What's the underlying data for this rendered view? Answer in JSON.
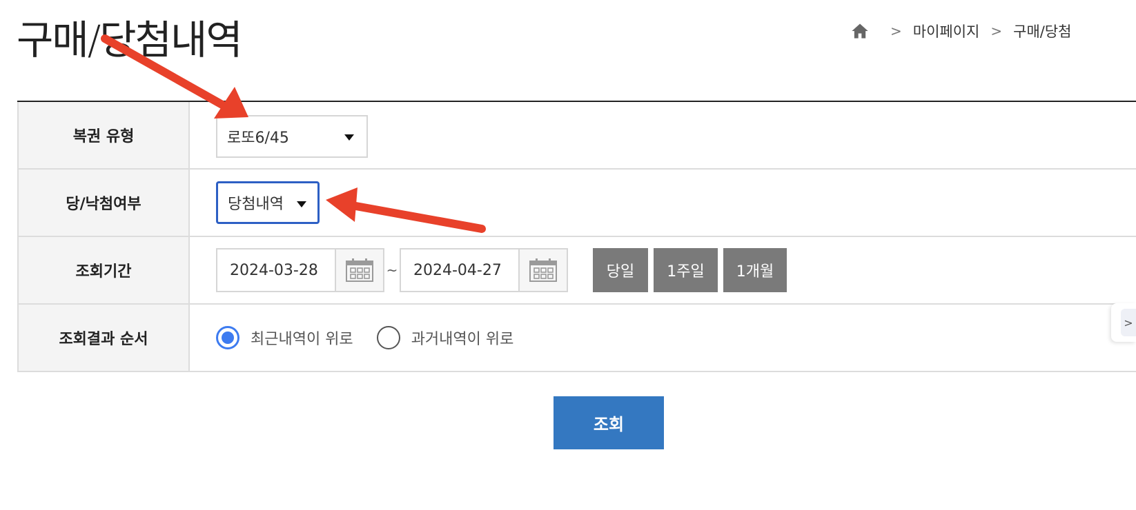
{
  "page": {
    "title": "구매/당첨내역"
  },
  "breadcrumb": {
    "items": [
      "마이페이지",
      "구매/당첨"
    ],
    "separator": ">"
  },
  "filters": {
    "lottery_type": {
      "label": "복권 유형",
      "selected": "로또6/45"
    },
    "win_status": {
      "label": "당/낙첨여부",
      "selected": "당첨내역"
    },
    "period": {
      "label": "조회기간",
      "start_date": "2024-03-28",
      "separator": "~",
      "end_date": "2024-04-27",
      "quick": {
        "today": "당일",
        "week": "1주일",
        "month": "1개월"
      }
    },
    "order": {
      "label": "조회결과 순서",
      "options": [
        {
          "label": "최근내역이 위로",
          "checked": true
        },
        {
          "label": "과거내역이 위로",
          "checked": false
        }
      ]
    }
  },
  "search_button": "조회",
  "side_tab": ">",
  "colors": {
    "accent_blue": "#3478c1",
    "focus_border": "#2d5fc4",
    "radio_blue": "#3d7bf0",
    "quick_button_gray": "#7a7a7a",
    "annotation_arrow": "#e8412a"
  }
}
